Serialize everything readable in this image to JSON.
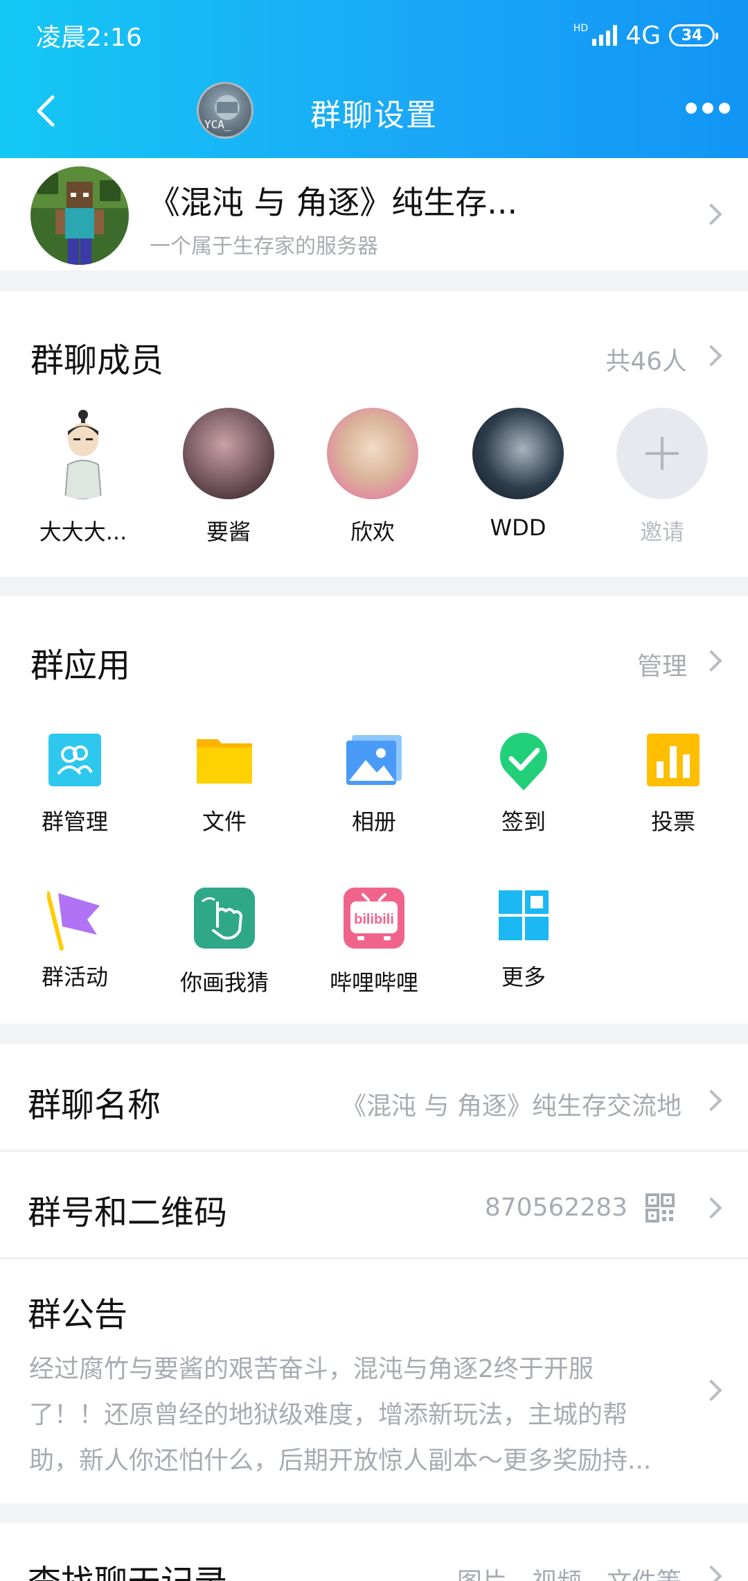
{
  "status_bar": {
    "time": "凌晨2:16",
    "hd": "HD",
    "network": "4G",
    "battery": "34"
  },
  "nav": {
    "title": "群聊设置",
    "avatar_tag": "YCA_"
  },
  "profile": {
    "name": "《混沌 与 角逐》纯生存...",
    "description": "一个属于生存家的服务器"
  },
  "members": {
    "title": "群聊成员",
    "count": "共46人",
    "items": [
      {
        "name": "大大大..."
      },
      {
        "name": "要酱"
      },
      {
        "name": "欣欢"
      },
      {
        "name": "WDD"
      }
    ],
    "invite_label": "邀请"
  },
  "apps": {
    "title": "群应用",
    "manage_label": "管理",
    "items": [
      {
        "label": "群管理",
        "icon": "group-manage-icon",
        "color": "#2ec8ee"
      },
      {
        "label": "文件",
        "icon": "folder-icon",
        "color": "#ffcc00"
      },
      {
        "label": "相册",
        "icon": "photo-album-icon",
        "color": "#4a9bf8"
      },
      {
        "label": "签到",
        "icon": "check-in-icon",
        "color": "#22d07a"
      },
      {
        "label": "投票",
        "icon": "vote-chart-icon",
        "color": "#ffbe00"
      },
      {
        "label": "群活动",
        "icon": "flag-icon",
        "color": "#b073f5"
      },
      {
        "label": "你画我猜",
        "icon": "draw-guess-icon",
        "color": "#2fa888"
      },
      {
        "label": "哔哩哔哩",
        "icon": "bilibili-icon",
        "color": "#f0648c"
      },
      {
        "label": "更多",
        "icon": "grid-more-icon",
        "color": "#1cb8f4"
      }
    ]
  },
  "group_name": {
    "label": "群聊名称",
    "value": "《混沌 与 角逐》纯生存交流地"
  },
  "group_number": {
    "label": "群号和二维码",
    "value": "870562283"
  },
  "notice": {
    "label": "群公告",
    "lines": [
      "经过腐竹与要酱的艰苦奋斗，混沌与角逐2终于开服",
      "了！！还原曾经的地狱级难度，增添新玩法，主城的帮",
      "助，新人你还怕什么，后期开放惊人副本～更多奖励持..."
    ]
  },
  "search_history": {
    "label": "查找聊天记录",
    "value": "图片、视频、文件等"
  }
}
